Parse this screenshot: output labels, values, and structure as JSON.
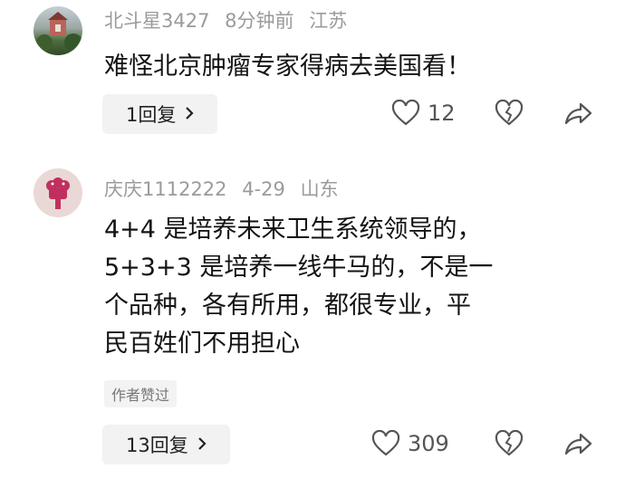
{
  "comments": [
    {
      "user": "北斗星3427",
      "time": "8分钟前",
      "location": "江苏",
      "text_lines": [
        "难怪北京肿瘤专家得病去美国看！"
      ],
      "reply_label": "1回复",
      "likes": "12",
      "badge": ""
    },
    {
      "user": "庆庆1112222",
      "time": "4-29",
      "location": "山东",
      "text_lines": [
        "4+4 是培养未来卫生系统领导的，",
        "5+3+3 是培养一线牛马的，不是一",
        "个品种，各有所用，都很专业，平",
        "民百姓们不用担心"
      ],
      "reply_label": "13回复",
      "likes": "309",
      "badge": "作者赞过"
    }
  ],
  "icons": {
    "like": "heart-outline-icon",
    "dislike": "broken-heart-icon",
    "share": "share-arrow-icon",
    "chevron": "chevron-right-icon"
  }
}
